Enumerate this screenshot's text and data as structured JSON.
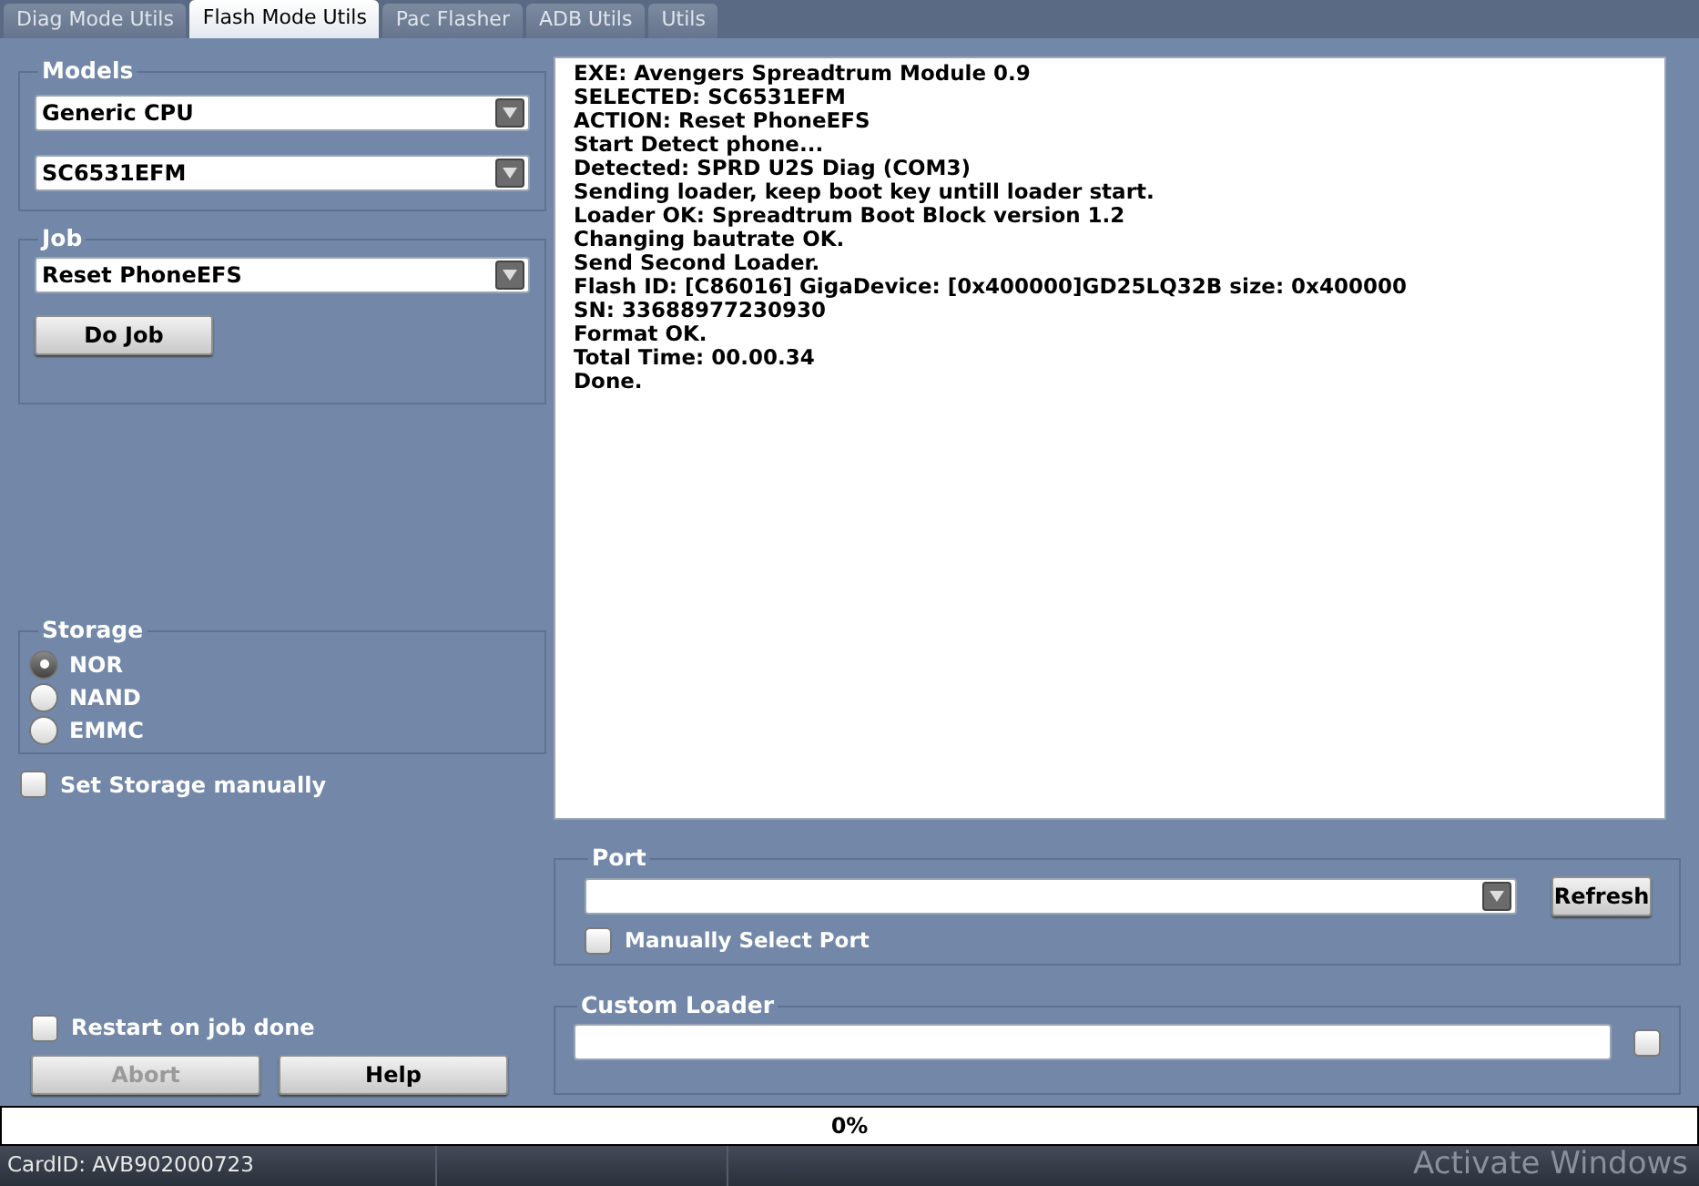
{
  "tabs": [
    {
      "label": "Diag Mode Utils",
      "selected": false
    },
    {
      "label": "Flash Mode Utils",
      "selected": true
    },
    {
      "label": "Pac Flasher",
      "selected": false
    },
    {
      "label": "ADB Utils",
      "selected": false
    },
    {
      "label": "Utils",
      "selected": false
    }
  ],
  "models": {
    "title": "Models",
    "dropdowns": [
      "Generic CPU",
      "SC6531EFM"
    ]
  },
  "job": {
    "title": "Job",
    "dropdown": "Reset PhoneEFS",
    "button": "Do Job"
  },
  "storage": {
    "title": "Storage",
    "options": [
      {
        "label": "NOR",
        "selected": true
      },
      {
        "label": "NAND",
        "selected": false
      },
      {
        "label": "EMMC",
        "selected": false
      }
    ]
  },
  "set_storage_manually": {
    "label": "Set Storage manually",
    "checked": false
  },
  "restart_on_job_done": {
    "label": "Restart on job done",
    "checked": false
  },
  "buttons": [
    {
      "label": "Abort",
      "disabled": true
    },
    {
      "label": "Help",
      "disabled": false
    }
  ],
  "log": [
    "EXE: Avengers Spreadtrum Module 0.9",
    "SELECTED: SC6531EFM",
    "ACTION: Reset PhoneEFS",
    "Start Detect phone...",
    "Detected: SPRD U2S Diag (COM3)",
    "Sending loader, keep boot key untill loader start.",
    "Loader OK: Spreadtrum Boot Block version 1.2",
    "Changing bautrate OK.",
    "Send Second Loader.",
    "Flash ID: [C86016] GigaDevice: [0x400000]GD25LQ32B size: 0x400000",
    "SN: 33688977230930",
    "Format OK.",
    "Total Time: 00.00.34",
    "Done."
  ],
  "port": {
    "title": "Port",
    "refresh": "Refresh",
    "manual": {
      "label": "Manually Select Port",
      "checked": false
    }
  },
  "custom_loader": {
    "title": "Custom Loader",
    "checked": false
  },
  "progress": {
    "level": 0,
    "text": "0%"
  },
  "status_bar": {
    "card_id": "CardID: AVB902000723",
    "overlay": "Activate Windows"
  }
}
